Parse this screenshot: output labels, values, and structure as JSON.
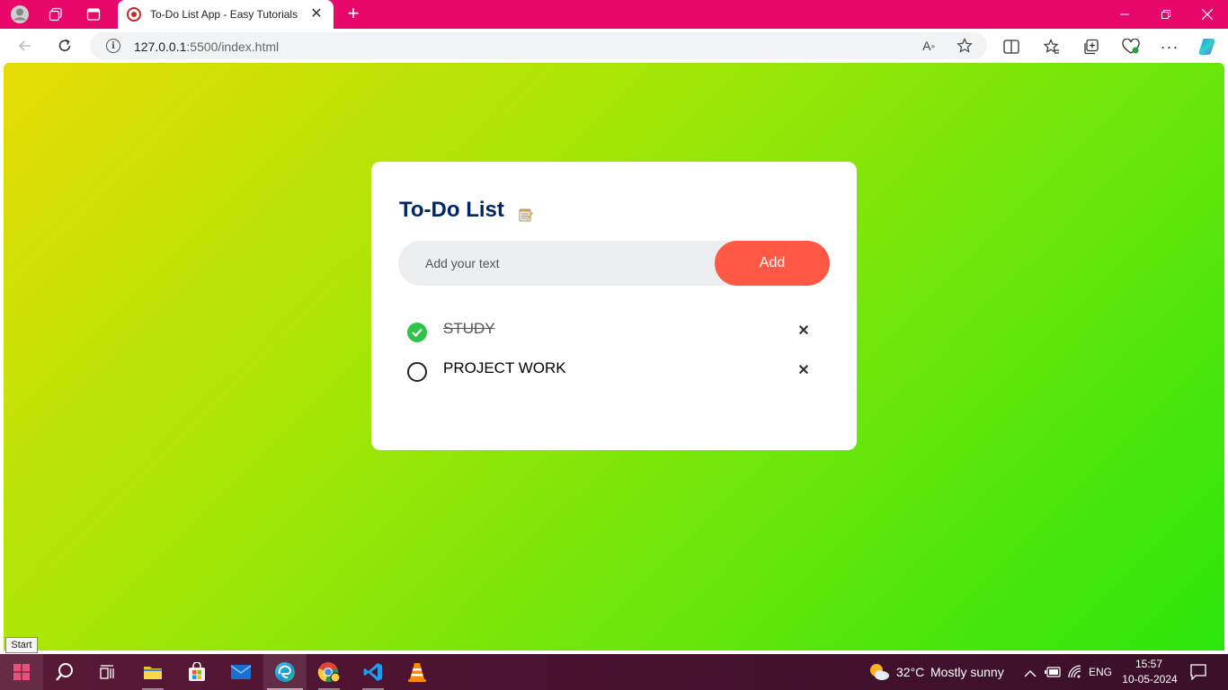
{
  "browser": {
    "tab_title": "To-Do List App - Easy Tutorials",
    "url_host": "127.0.0.1",
    "url_path": ":5500/index.html"
  },
  "app": {
    "title": "To-Do List",
    "input_placeholder": "Add your text",
    "add_button": "Add",
    "tasks": [
      {
        "label": "STUDY",
        "done": true
      },
      {
        "label": "PROJECT WORK",
        "done": false
      }
    ]
  },
  "tooltip": "Start",
  "taskbar": {
    "weather_temp": "32°C",
    "weather_desc": "Mostly sunny",
    "language": "ENG",
    "time": "15:57",
    "date": "10-05-2024"
  },
  "colors": {
    "titlebar": "#e8076a",
    "card_title": "#002765",
    "add_button": "#ff5945",
    "check_done": "#2ec44a"
  }
}
